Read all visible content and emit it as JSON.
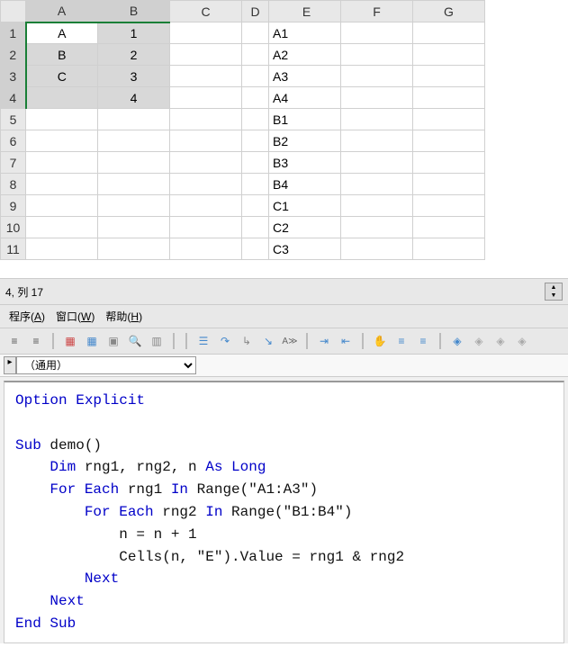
{
  "spreadsheet": {
    "col_headers": [
      "A",
      "B",
      "C",
      "D",
      "E",
      "F",
      "G"
    ],
    "row_headers": [
      "1",
      "2",
      "3",
      "4",
      "5",
      "6",
      "7",
      "8",
      "9",
      "10",
      "11"
    ],
    "cells": {
      "A1": "A",
      "A2": "B",
      "A3": "C",
      "B1": "1",
      "B2": "2",
      "B3": "3",
      "B4": "4",
      "E1": "A1",
      "E2": "A2",
      "E3": "A3",
      "E4": "A4",
      "E5": "B1",
      "E6": "B2",
      "E7": "B3",
      "E8": "B4",
      "E9": "C1",
      "E10": "C2",
      "E11": "C3"
    }
  },
  "vba": {
    "status": "4, 列 17",
    "menus": {
      "procedure": {
        "label": "程序",
        "accel": "A"
      },
      "window": {
        "label": "窗口",
        "accel": "W"
      },
      "help": {
        "label": "帮助",
        "accel": "H"
      }
    },
    "module_dropdown": "（通用）",
    "code_tokens": [
      [
        {
          "t": "Option Explicit",
          "c": "kw"
        }
      ],
      [],
      [
        {
          "t": "Sub",
          "c": "kw"
        },
        {
          "t": " demo()",
          "c": "txt"
        }
      ],
      [
        {
          "t": "    ",
          "c": "txt"
        },
        {
          "t": "Dim",
          "c": "kw"
        },
        {
          "t": " rng1, rng2, n ",
          "c": "txt"
        },
        {
          "t": "As Long",
          "c": "kw"
        }
      ],
      [
        {
          "t": "    ",
          "c": "txt"
        },
        {
          "t": "For Each",
          "c": "kw"
        },
        {
          "t": " rng1 ",
          "c": "txt"
        },
        {
          "t": "In",
          "c": "kw"
        },
        {
          "t": " Range(\"A1:A3\")",
          "c": "txt"
        }
      ],
      [
        {
          "t": "        ",
          "c": "txt"
        },
        {
          "t": "For Each",
          "c": "kw"
        },
        {
          "t": " rng2 ",
          "c": "txt"
        },
        {
          "t": "In",
          "c": "kw"
        },
        {
          "t": " Range(\"B1:B4\")",
          "c": "txt"
        }
      ],
      [
        {
          "t": "            n = n + 1",
          "c": "txt"
        }
      ],
      [
        {
          "t": "            Cells(n, \"E\").Value = rng1 & rng2",
          "c": "txt"
        }
      ],
      [
        {
          "t": "        ",
          "c": "txt"
        },
        {
          "t": "Next",
          "c": "kw"
        }
      ],
      [
        {
          "t": "    ",
          "c": "txt"
        },
        {
          "t": "Next",
          "c": "kw"
        }
      ],
      [
        {
          "t": "End Sub",
          "c": "kw"
        }
      ]
    ]
  }
}
